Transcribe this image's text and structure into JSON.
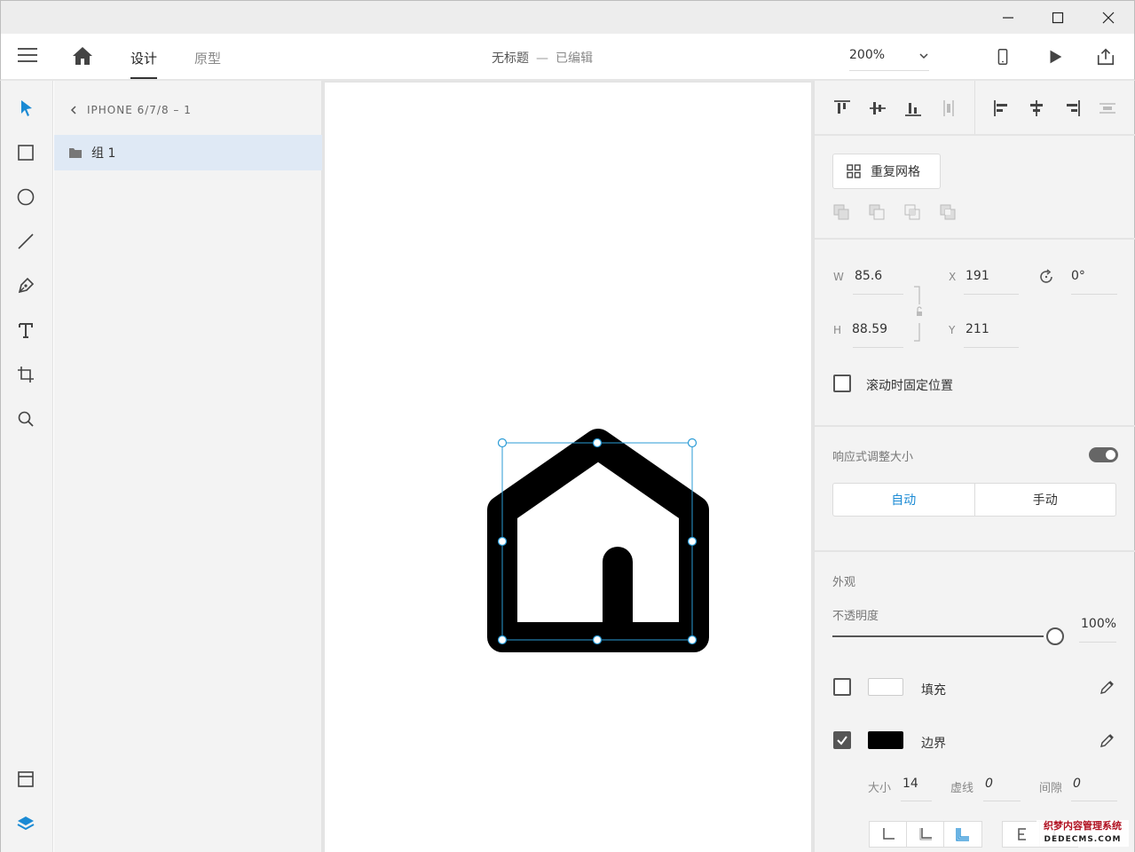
{
  "window": {
    "minimize_icon": "minimize-icon",
    "maximize_icon": "maximize-icon",
    "close_icon": "close-icon"
  },
  "header": {
    "menu_icon": "hamburger-menu-icon",
    "home_icon": "home-icon",
    "tabs": [
      {
        "label": "设计",
        "active": true
      },
      {
        "label": "原型",
        "active": false
      }
    ],
    "document_title": "无标题",
    "separator": "—",
    "edit_status": "已编辑",
    "zoom": "200%",
    "device_preview_icon": "mobile-device-icon",
    "play_icon": "play-icon",
    "share_icon": "share-icon"
  },
  "toolbar": {
    "tools": [
      "select-tool-icon",
      "rectangle-tool-icon",
      "ellipse-tool-icon",
      "line-tool-icon",
      "pen-tool-icon",
      "text-tool-icon",
      "artboard-tool-icon",
      "zoom-tool-icon"
    ],
    "bottom": [
      "assets-panel-icon",
      "layers-panel-icon"
    ],
    "accent": "#1a8ad4"
  },
  "layers": {
    "artboard_name": "IPHONE 6/7/8 – 1",
    "items": [
      {
        "name": "组 1",
        "icon": "folder-icon",
        "selected": true
      }
    ]
  },
  "inspector": {
    "repeat_grid_label": "重复网格",
    "width_label": "W",
    "width": "85.6",
    "height_label": "H",
    "height": "88.59",
    "x_label": "X",
    "x": "191",
    "y_label": "Y",
    "y": "211",
    "rotation": "0°",
    "fix_position_label": "滚动时固定位置",
    "responsive_label": "响应式调整大小",
    "responsive_on": true,
    "auto_label": "自动",
    "manual_label": "手动",
    "appearance_label": "外观",
    "opacity_label": "不透明度",
    "opacity_value": "100%",
    "opacity": 1.0,
    "fill_label": "填充",
    "fill_enabled": false,
    "fill_color": "#ffffff",
    "border_label": "边界",
    "border_enabled": true,
    "border_color": "#000000",
    "size_label": "大小",
    "size_value": "14",
    "dash_label": "虚线",
    "dash_value": "0",
    "gap_label": "间隙",
    "gap_value": "0"
  },
  "watermark": {
    "line1": "织梦内容管理系统",
    "line2": "DEDECMS.COM"
  }
}
